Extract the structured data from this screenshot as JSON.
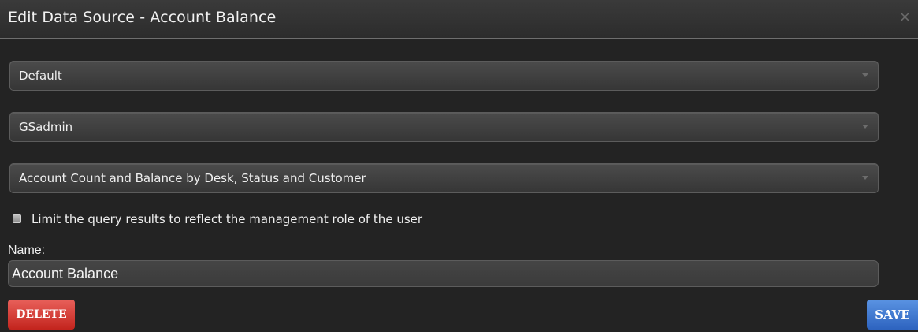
{
  "dialog": {
    "title": "Edit Data Source - Account Balance",
    "close_glyph": "×"
  },
  "selects": {
    "connection": {
      "value": "Default"
    },
    "user": {
      "value": "GSadmin"
    },
    "query": {
      "value": "Account Count and Balance by Desk, Status and Customer"
    }
  },
  "limit_checkbox": {
    "label": "Limit the query results to reflect the management role of the user",
    "checked": false
  },
  "name_field": {
    "label": "Name:",
    "value": "Account Balance"
  },
  "buttons": {
    "delete_label": "DELETE",
    "save_label": "SAVE"
  },
  "colors": {
    "dialog_bg": "#232323",
    "delete": "#c3241d",
    "save": "#2d63bf"
  },
  "icons": {
    "close": "close-icon",
    "dropdown": "chevron-down-icon"
  }
}
